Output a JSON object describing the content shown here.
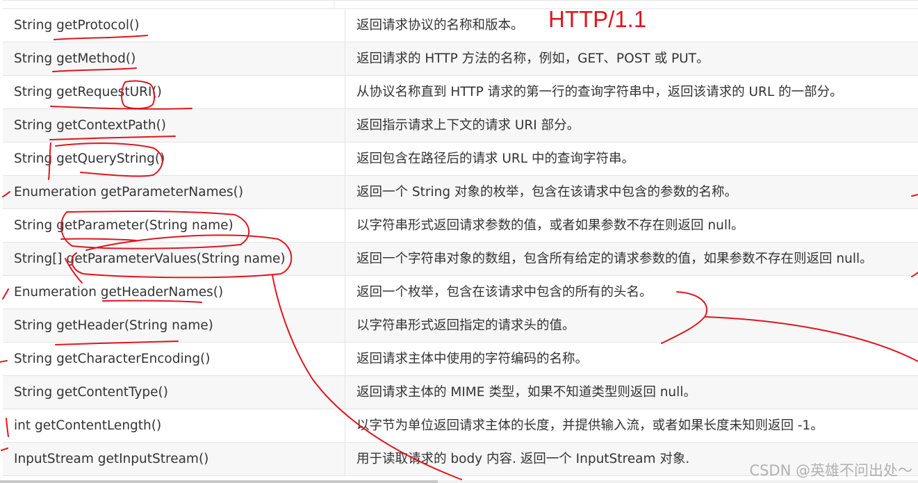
{
  "table": {
    "rows": [
      {
        "method": "String getProtocol()",
        "description": "返回请求协议的名称和版本。"
      },
      {
        "method": "String getMethod()",
        "description": "返回请求的 HTTP 方法的名称，例如，GET、POST 或 PUT。"
      },
      {
        "method": "String getRequestURI()",
        "description": "从协议名称直到 HTTP 请求的第一行的查询字符串中，返回该请求的 URL 的一部分。"
      },
      {
        "method": "String getContextPath()",
        "description": "返回指示请求上下文的请求 URI 部分。"
      },
      {
        "method": "String getQueryString()",
        "description": "返回包含在路径后的请求 URL 中的查询字符串。"
      },
      {
        "method": "Enumeration getParameterNames()",
        "description": "返回一个 String 对象的枚举，包含在该请求中包含的参数的名称。"
      },
      {
        "method": "String getParameter(String name)",
        "description": "以字符串形式返回请求参数的值，或者如果参数不存在则返回 null。"
      },
      {
        "method": "String[] getParameterValues(String name)",
        "description": "返回一个字符串对象的数组，包含所有给定的请求参数的值，如果参数不存在则返回 null。"
      },
      {
        "method": "Enumeration getHeaderNames()",
        "description": "返回一个枚举，包含在该请求中包含的所有的头名。"
      },
      {
        "method": "String getHeader(String name)",
        "description": "以字符串形式返回指定的请求头的值。"
      },
      {
        "method": "String getCharacterEncoding()",
        "description": "返回请求主体中使用的字符编码的名称。"
      },
      {
        "method": "String getContentType()",
        "description": "返回请求主体的 MIME 类型，如果不知道类型则返回 null。"
      },
      {
        "method": "int getContentLength()",
        "description": "以字节为单位返回请求主体的长度，并提供输入流，或者如果长度未知则返回 -1。"
      },
      {
        "method": "InputStream getInputStream()",
        "description": "用于读取请求的 body 内容. 返回一个 InputStream 对象."
      }
    ]
  },
  "annotation": {
    "note_text": "HTTP/1.1",
    "ink_color": "#e0141e"
  },
  "watermark": {
    "text": "CSDN @英雄不问出处～"
  }
}
